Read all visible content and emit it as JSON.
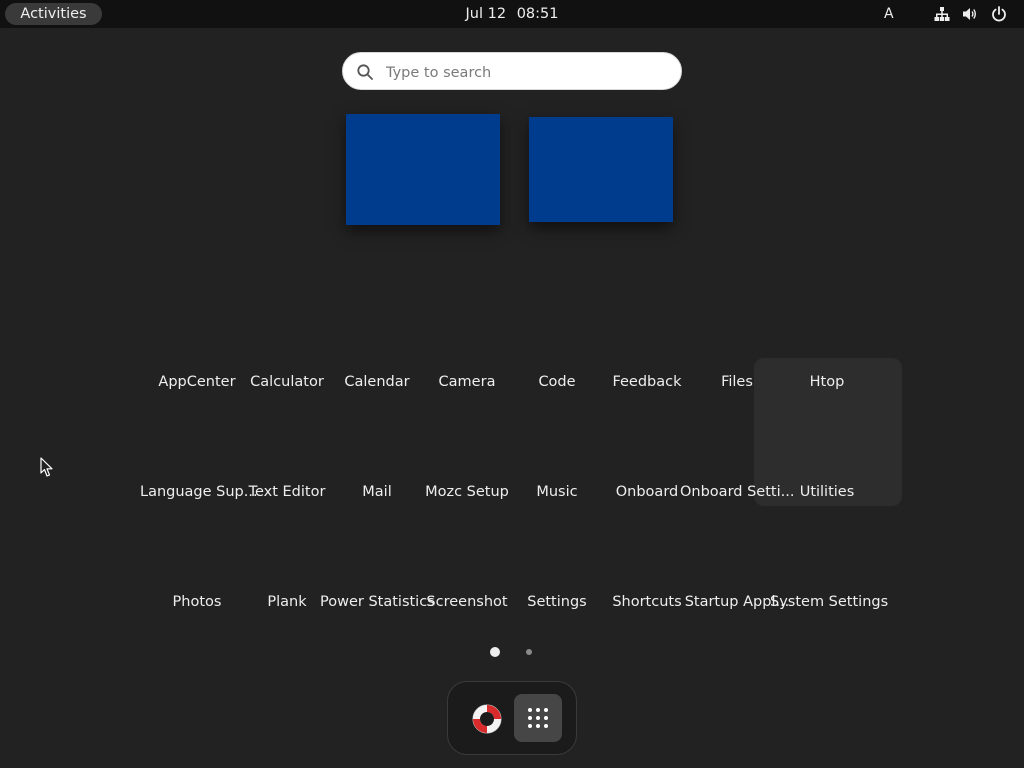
{
  "topbar": {
    "activities_label": "Activities",
    "date": "Jul 12",
    "time": "08:51",
    "keyboard_layout": "A",
    "tray_icons": [
      "network-icon",
      "volume-icon",
      "power-icon"
    ]
  },
  "search": {
    "placeholder": "Type to search"
  },
  "workspaces": {
    "color": "#003c8e",
    "count": 2
  },
  "apps": {
    "items": [
      {
        "label": "AppCenter"
      },
      {
        "label": "Calculator"
      },
      {
        "label": "Calendar"
      },
      {
        "label": "Camera"
      },
      {
        "label": "Code"
      },
      {
        "label": "Feedback"
      },
      {
        "label": "Files"
      },
      {
        "label": "Htop"
      },
      {
        "label": "Language Sup..."
      },
      {
        "label": "Text Editor"
      },
      {
        "label": "Mail"
      },
      {
        "label": "Mozc Setup"
      },
      {
        "label": "Music"
      },
      {
        "label": "Onboard"
      },
      {
        "label": "Onboard Setti..."
      },
      {
        "label": "Utilities"
      },
      {
        "label": "Photos"
      },
      {
        "label": "Plank"
      },
      {
        "label": "Power Statistics"
      },
      {
        "label": "Screenshot"
      },
      {
        "label": "Settings"
      },
      {
        "label": "Shortcuts"
      },
      {
        "label": "Startup Appl..."
      },
      {
        "label": "System Settings"
      }
    ],
    "selected": "Utilities"
  },
  "pager": {
    "pages": 2,
    "current": 1
  },
  "dock": {
    "items": [
      "help-icon",
      "show-apps-icon"
    ]
  },
  "colors": {
    "background": "#222222",
    "topbar": "#111111",
    "accent": "#003c8e"
  }
}
